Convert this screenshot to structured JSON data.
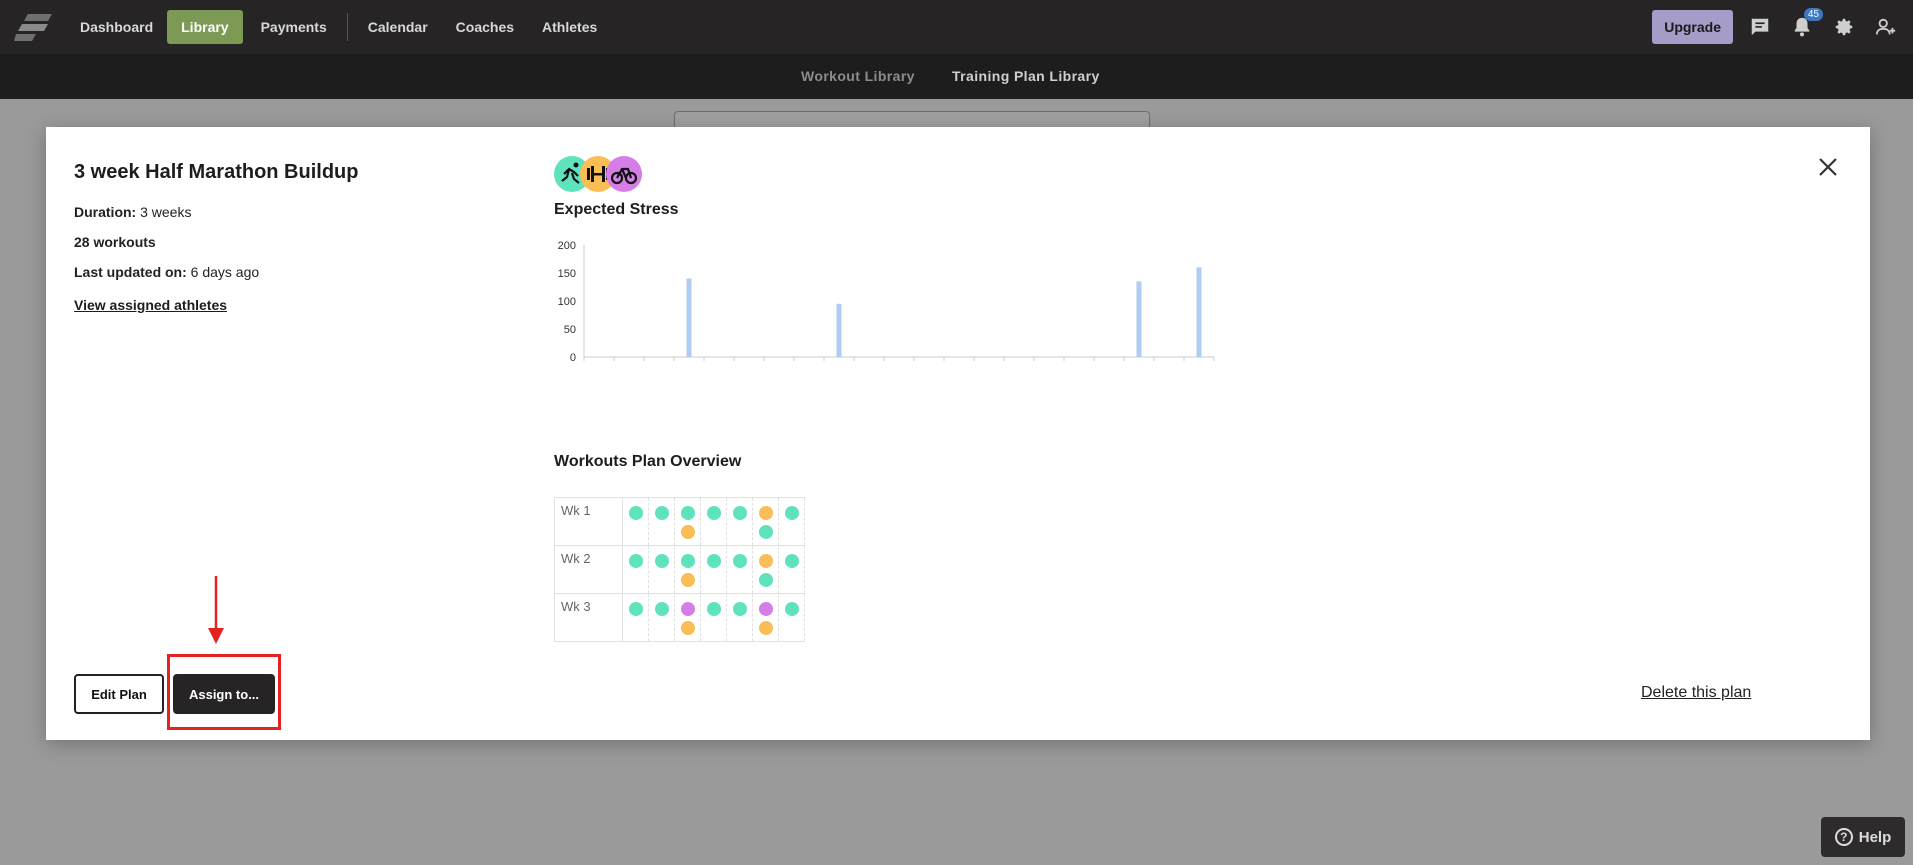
{
  "nav": {
    "items": [
      "Dashboard",
      "Library",
      "Payments",
      "Calendar",
      "Coaches",
      "Athletes"
    ],
    "active": "Library",
    "upgrade_label": "Upgrade",
    "notification_count": "45"
  },
  "subnav": {
    "tabs": [
      "Workout Library",
      "Training Plan Library"
    ],
    "active": "Training Plan Library"
  },
  "modal": {
    "title": "3 week Half Marathon Buildup",
    "duration_label": "Duration:",
    "duration_value": " 3 weeks",
    "workouts": "28 workouts",
    "updated_label": "Last updated on:",
    "updated_value": " 6 days ago",
    "view_athletes": "View assigned athletes",
    "sports": [
      "run-icon",
      "strength-icon",
      "bike-icon"
    ],
    "expected_stress_title": "Expected Stress",
    "overview_title": "Workouts Plan Overview",
    "edit_label": "Edit Plan",
    "assign_label": "Assign to...",
    "delete_label": "Delete this plan"
  },
  "chart_data": {
    "type": "bar",
    "title": "Expected Stress",
    "ylim": [
      0,
      200
    ],
    "yticks": [
      0,
      50,
      100,
      150,
      200
    ],
    "x": [
      1,
      2,
      3,
      4,
      5,
      6,
      7,
      8,
      9,
      10,
      11,
      12,
      13,
      14,
      15,
      16,
      17,
      18,
      19,
      20,
      21
    ],
    "values": [
      0,
      0,
      0,
      140,
      0,
      0,
      0,
      0,
      95,
      0,
      0,
      0,
      0,
      0,
      0,
      0,
      0,
      0,
      135,
      0,
      160
    ],
    "bar_color": "#aecdf0"
  },
  "plan_overview": {
    "weeks": [
      {
        "label": "Wk 1",
        "days": [
          [
            "run"
          ],
          [
            "run"
          ],
          [
            "run",
            "strength"
          ],
          [
            "run"
          ],
          [
            "run"
          ],
          [
            "strength",
            "run"
          ],
          [
            "run"
          ]
        ]
      },
      {
        "label": "Wk 2",
        "days": [
          [
            "run"
          ],
          [
            "run"
          ],
          [
            "run",
            "strength"
          ],
          [
            "run"
          ],
          [
            "run"
          ],
          [
            "strength",
            "run"
          ],
          [
            "run"
          ]
        ]
      },
      {
        "label": "Wk 3",
        "days": [
          [
            "run"
          ],
          [
            "run"
          ],
          [
            "bike",
            "strength"
          ],
          [
            "run"
          ],
          [
            "run"
          ],
          [
            "bike",
            "strength"
          ],
          [
            "run"
          ]
        ]
      }
    ],
    "colors": {
      "run": "#5ee3bd",
      "strength": "#fbbd55",
      "bike": "#d67ee8"
    }
  },
  "help_label": "Help"
}
